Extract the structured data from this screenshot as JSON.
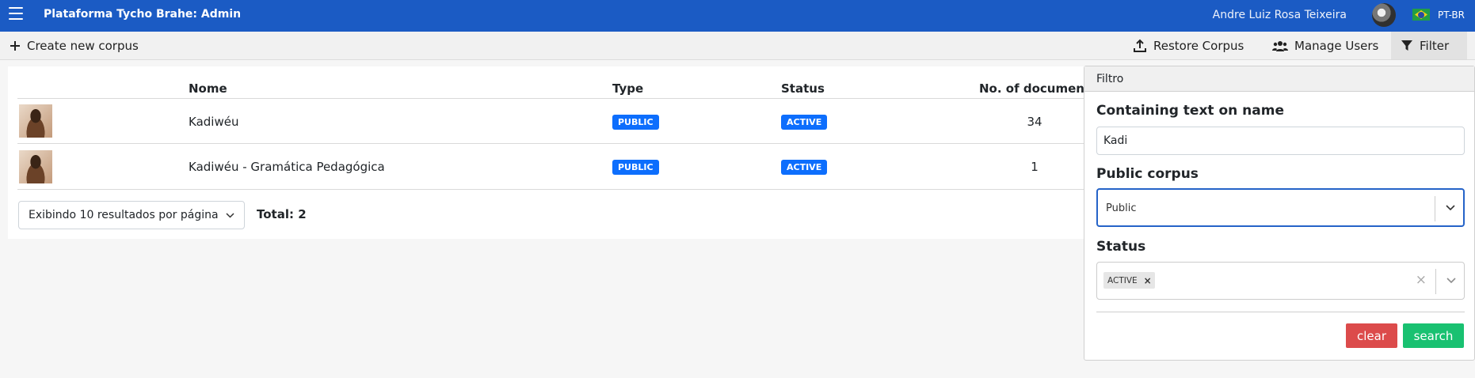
{
  "header": {
    "title": "Plataforma Tycho Brahe: Admin",
    "user_name": "Andre Luiz Rosa Teixeira",
    "language": "PT-BR"
  },
  "toolbar": {
    "create_label": "Create new corpus",
    "restore_label": "Restore Corpus",
    "users_label": "Manage Users",
    "filter_label": "Filter"
  },
  "table": {
    "columns": [
      "Nome",
      "Type",
      "Status",
      "No. of document"
    ],
    "rows": [
      {
        "name": "Kadiwéu",
        "type": "PUBLIC",
        "status": "ACTIVE",
        "documents": "34"
      },
      {
        "name": "Kadiwéu - Gramática Pedagógica",
        "type": "PUBLIC",
        "status": "ACTIVE",
        "documents": "1"
      }
    ]
  },
  "pagination": {
    "per_page_label": "Exibindo 10 resultados por página",
    "total_label": "Total: 2"
  },
  "filter_panel": {
    "title": "Filtro",
    "name_label": "Containing text on name",
    "name_value": "Kadi",
    "public_label": "Public corpus",
    "public_value": "Public",
    "status_label": "Status",
    "status_chip": "ACTIVE",
    "clear_label": "clear",
    "search_label": "search"
  },
  "colors": {
    "header_bg": "#1b5bc4",
    "badge_blue": "#0d6efd",
    "clear_red": "#dc4b4b",
    "search_green": "#19c171"
  }
}
